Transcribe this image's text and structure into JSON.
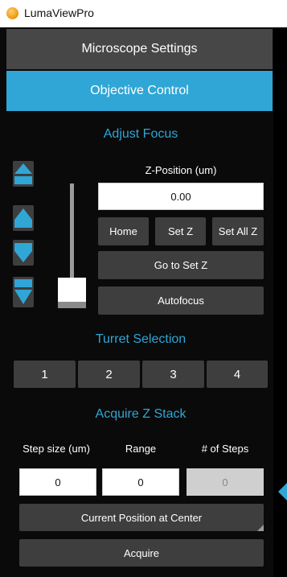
{
  "window": {
    "title": "LumaViewPro"
  },
  "accordion": {
    "microscope_settings": "Microscope Settings",
    "objective_control": "Objective Control"
  },
  "focus": {
    "heading": "Adjust Focus",
    "z_label": "Z-Position (um)",
    "z_value": "0.00",
    "home": "Home",
    "set_z": "Set Z",
    "set_all_z": "Set All Z",
    "go_to_set_z": "Go to Set Z",
    "autofocus": "Autofocus",
    "slider_level": 0.0
  },
  "turret": {
    "heading": "Turret Selection",
    "positions": [
      "1",
      "2",
      "3",
      "4"
    ]
  },
  "zstack": {
    "heading": "Acquire Z Stack",
    "step_label": "Step size (um)",
    "range_label": "Range",
    "steps_label": "# of Steps",
    "step_value": "0",
    "range_value": "0",
    "steps_value": "0",
    "current_center": "Current Position at Center",
    "acquire": "Acquire"
  },
  "colors": {
    "accent": "#2fa6d6",
    "button": "#3e3e3e",
    "panel": "#0a0a0a"
  }
}
